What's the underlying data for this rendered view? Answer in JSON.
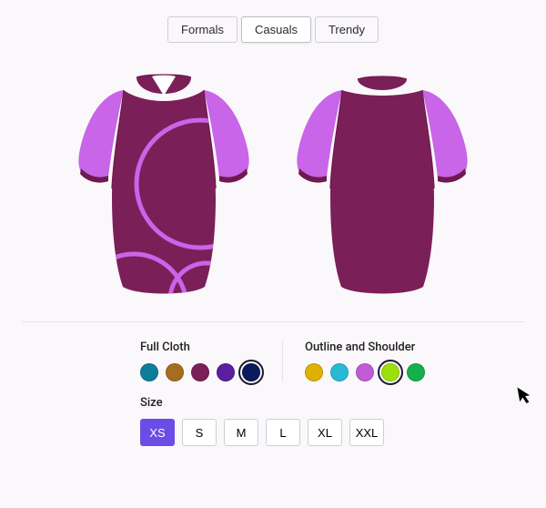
{
  "tabs": [
    "Formals",
    "Casuals",
    "Trendy"
  ],
  "tab_selected": 1,
  "colors": {
    "body": "#7b1f59",
    "sleeve": "#c865e8",
    "trim": "#6f1a4f",
    "accent": "#c865e8",
    "collar_white": "#ffffff"
  },
  "full_cloth": {
    "label": "Full Cloth",
    "swatches": [
      "#0d7d9b",
      "#a66c1f",
      "#7b1f59",
      "#5a1fa0",
      "#0b1a5c"
    ],
    "selected": 4
  },
  "outline_shoulder": {
    "label": "Outline and Shoulder",
    "swatches": [
      "#e0b000",
      "#28b9d6",
      "#c25bd6",
      "#9ce00b",
      "#16b04a"
    ],
    "selected": 3
  },
  "size": {
    "label": "Size",
    "options": [
      "XS",
      "S",
      "M",
      "L",
      "XL",
      "XXL"
    ],
    "selected": 0
  }
}
